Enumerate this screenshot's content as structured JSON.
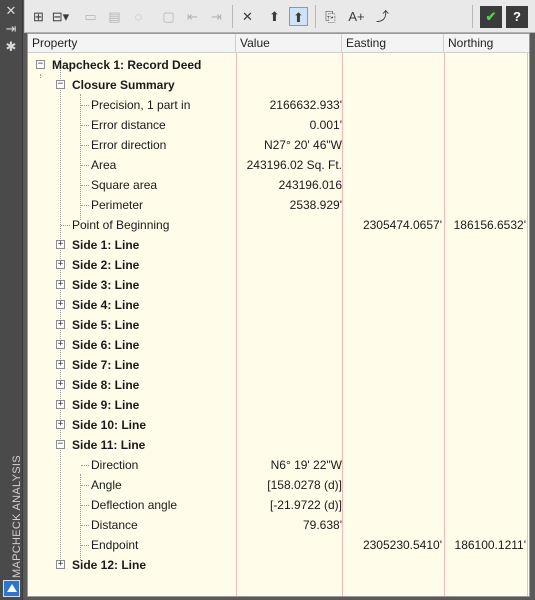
{
  "palette": {
    "title": "MAPCHECK ANALYSIS"
  },
  "columns": {
    "property": "Property",
    "value": "Value",
    "easting": "Easting",
    "northing": "Northing"
  },
  "tree": {
    "mapcheck": "Mapcheck 1: Record Deed",
    "closure": {
      "label": "Closure Summary",
      "items": [
        {
          "label": "Precision, 1 part in",
          "value": "2166632.933'"
        },
        {
          "label": "Error distance",
          "value": "0.001'"
        },
        {
          "label": "Error direction",
          "value": "N27° 20' 46\"W"
        },
        {
          "label": "Area",
          "value": "243196.02 Sq. Ft."
        },
        {
          "label": "Square area",
          "value": "243196.016"
        },
        {
          "label": "Perimeter",
          "value": "2538.929'"
        }
      ]
    },
    "pob": {
      "label": "Point of Beginning",
      "easting": "2305474.0657'",
      "northing": "186156.6532'"
    },
    "sides_collapsed": [
      "Side 1: Line",
      "Side 2: Line",
      "Side 3: Line",
      "Side 4: Line",
      "Side 5: Line",
      "Side 6: Line",
      "Side 7: Line",
      "Side 8: Line",
      "Side 9: Line",
      "Side 10: Line"
    ],
    "side11": {
      "label": "Side 11: Line",
      "items": [
        {
          "label": "Direction",
          "value": "N6° 19' 22\"W"
        },
        {
          "label": "Angle",
          "value": "[158.0278 (d)]"
        },
        {
          "label": "Deflection angle",
          "value": "[-21.9722 (d)]"
        },
        {
          "label": "Distance",
          "value": "79.638'"
        }
      ],
      "endpoint": {
        "label": "Endpoint",
        "easting": "2305230.5410'",
        "northing": "186100.1211'"
      }
    },
    "side12": "Side 12: Line"
  }
}
